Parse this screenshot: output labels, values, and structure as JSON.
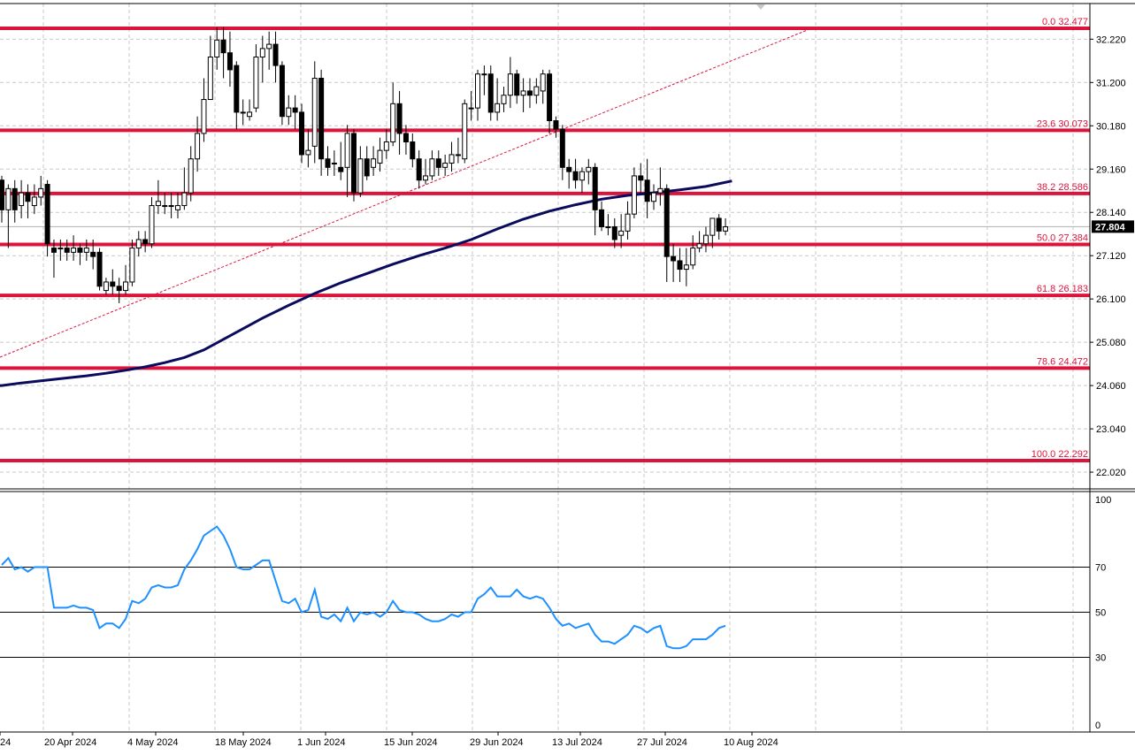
{
  "chart_data": [
    {
      "type": "candlestick",
      "price_axis_ticks": [
        "32.220",
        "31.200",
        "30.180",
        "29.160",
        "28.140",
        "27.120",
        "26.100",
        "25.080",
        "24.060",
        "23.040",
        "22.020"
      ],
      "date_labels": [
        "24",
        "20 Apr 2024",
        "4 May 2024",
        "18 May 2024",
        "1 Jun 2024",
        "15 Jun 2024",
        "29 Jun 2024",
        "13 Jul 2024",
        "27 Jul 2024",
        "10 Aug 2024"
      ],
      "ylim": [
        21.75,
        32.75
      ],
      "current_price": "27.804",
      "fibonacci": [
        {
          "label": "0.0 32.477",
          "value": 32.477
        },
        {
          "label": "23.6 30.073",
          "value": 30.073
        },
        {
          "label": "38.2 28.586",
          "value": 28.586
        },
        {
          "label": "50.0 27.384",
          "value": 27.384
        },
        {
          "label": "61.8 26.183",
          "value": 26.183
        },
        {
          "label": "78.6 24.472",
          "value": 24.472
        },
        {
          "label": "100.0 22.292",
          "value": 22.292
        }
      ],
      "candles": [
        [
          28.9,
          28.2,
          29.0,
          27.9
        ],
        [
          28.2,
          28.7,
          28.8,
          27.3
        ],
        [
          28.7,
          28.2,
          28.9,
          27.9
        ],
        [
          28.3,
          28.6,
          28.9,
          28.0
        ],
        [
          28.6,
          28.4,
          28.8,
          28.0
        ],
        [
          28.3,
          28.5,
          28.8,
          28.1
        ],
        [
          28.5,
          28.7,
          29.0,
          28.3
        ],
        [
          28.8,
          27.4,
          28.9,
          27.1
        ],
        [
          27.3,
          27.2,
          27.5,
          26.6
        ],
        [
          27.3,
          27.3,
          27.5,
          27.0
        ],
        [
          27.3,
          27.2,
          27.5,
          27.0
        ],
        [
          27.2,
          27.3,
          27.6,
          27.0
        ],
        [
          27.3,
          27.2,
          27.4,
          26.9
        ],
        [
          27.2,
          27.3,
          27.5,
          27.0
        ],
        [
          27.2,
          27.1,
          27.5,
          26.8
        ],
        [
          27.2,
          26.4,
          27.3,
          26.3
        ],
        [
          26.3,
          26.5,
          26.6,
          26.2
        ],
        [
          26.5,
          26.4,
          26.8,
          26.2
        ],
        [
          26.4,
          26.3,
          26.6,
          26.0
        ],
        [
          26.3,
          26.5,
          26.9,
          26.2
        ],
        [
          26.5,
          27.3,
          27.5,
          26.4
        ],
        [
          27.3,
          27.5,
          27.7,
          27.1
        ],
        [
          27.5,
          27.4,
          27.7,
          27.2
        ],
        [
          27.4,
          28.3,
          28.5,
          27.3
        ],
        [
          28.3,
          28.4,
          28.9,
          28.1
        ],
        [
          28.3,
          28.3,
          28.6,
          28.1
        ],
        [
          28.3,
          28.3,
          28.6,
          28.0
        ],
        [
          28.2,
          28.3,
          28.6,
          28.0
        ],
        [
          28.3,
          28.6,
          29.2,
          28.2
        ],
        [
          28.6,
          29.4,
          29.7,
          28.4
        ],
        [
          29.4,
          30.0,
          30.4,
          29.1
        ],
        [
          30.0,
          30.8,
          31.3,
          29.8
        ],
        [
          30.8,
          31.8,
          32.3,
          30.8
        ],
        [
          31.8,
          32.2,
          32.5,
          31.5
        ],
        [
          32.2,
          31.9,
          32.5,
          31.3
        ],
        [
          31.9,
          31.5,
          32.4,
          31.1
        ],
        [
          31.6,
          30.5,
          31.7,
          30.1
        ],
        [
          30.5,
          30.5,
          30.8,
          30.2
        ],
        [
          30.4,
          30.5,
          30.8,
          30.3
        ],
        [
          30.6,
          31.8,
          32.1,
          30.5
        ],
        [
          31.8,
          32.0,
          32.3,
          31.2
        ],
        [
          32.0,
          32.1,
          32.4,
          31.5
        ],
        [
          32.1,
          31.6,
          32.4,
          31.2
        ],
        [
          31.6,
          30.4,
          31.7,
          30.2
        ],
        [
          30.4,
          30.6,
          30.9,
          30.2
        ],
        [
          30.6,
          30.5,
          30.9,
          30.1
        ],
        [
          30.5,
          29.5,
          30.7,
          29.3
        ],
        [
          29.5,
          29.6,
          30.1,
          29.2
        ],
        [
          29.7,
          31.3,
          31.7,
          29.3
        ],
        [
          31.3,
          29.4,
          31.5,
          29.0
        ],
        [
          29.4,
          29.2,
          29.7,
          29.0
        ],
        [
          29.3,
          29.3,
          29.6,
          29.0
        ],
        [
          29.2,
          29.1,
          29.8,
          28.9
        ],
        [
          29.2,
          30.0,
          30.2,
          28.5
        ],
        [
          30.0,
          28.6,
          30.1,
          28.4
        ],
        [
          28.6,
          29.4,
          29.7,
          28.5
        ],
        [
          29.4,
          29.0,
          29.7,
          28.9
        ],
        [
          29.2,
          29.4,
          29.7,
          29.0
        ],
        [
          29.3,
          29.6,
          29.9,
          29.1
        ],
        [
          29.6,
          29.8,
          30.1,
          29.4
        ],
        [
          29.8,
          30.7,
          31.2,
          29.7
        ],
        [
          30.7,
          30.0,
          31.0,
          29.5
        ],
        [
          30.0,
          29.8,
          30.2,
          29.5
        ],
        [
          29.8,
          29.4,
          30.0,
          29.2
        ],
        [
          29.4,
          28.9,
          29.6,
          28.7
        ],
        [
          28.9,
          29.0,
          29.4,
          28.8
        ],
        [
          29.0,
          29.4,
          29.6,
          28.9
        ],
        [
          29.4,
          29.2,
          29.6,
          29.0
        ],
        [
          29.2,
          29.3,
          29.5,
          29.0
        ],
        [
          29.3,
          29.5,
          29.8,
          29.1
        ],
        [
          29.5,
          29.5,
          29.9,
          29.3
        ],
        [
          29.4,
          30.7,
          30.8,
          29.3
        ],
        [
          30.6,
          30.6,
          31.0,
          30.3
        ],
        [
          30.6,
          31.4,
          31.5,
          30.3
        ],
        [
          31.4,
          31.4,
          31.6,
          30.9
        ],
        [
          31.4,
          30.5,
          31.6,
          30.3
        ],
        [
          30.5,
          30.7,
          31.3,
          30.3
        ],
        [
          30.7,
          30.9,
          31.1,
          30.5
        ],
        [
          30.9,
          31.4,
          31.8,
          30.6
        ],
        [
          31.4,
          30.9,
          31.5,
          30.7
        ],
        [
          30.9,
          31.0,
          31.3,
          30.5
        ],
        [
          31.0,
          30.9,
          31.3,
          30.6
        ],
        [
          30.9,
          31.1,
          31.3,
          30.7
        ],
        [
          31.0,
          31.4,
          31.5,
          30.7
        ],
        [
          31.4,
          30.3,
          31.5,
          30.0
        ],
        [
          30.3,
          30.1,
          30.4,
          29.9
        ],
        [
          30.1,
          29.2,
          30.2,
          28.9
        ],
        [
          29.2,
          29.1,
          29.4,
          28.7
        ],
        [
          29.1,
          28.9,
          29.4,
          28.7
        ],
        [
          28.9,
          29.1,
          29.2,
          28.6
        ],
        [
          29.1,
          29.2,
          29.4,
          28.8
        ],
        [
          29.2,
          28.2,
          29.3,
          27.6
        ],
        [
          28.2,
          27.8,
          28.4,
          27.7
        ],
        [
          27.8,
          27.8,
          28.1,
          27.6
        ],
        [
          27.8,
          27.5,
          28.0,
          27.3
        ],
        [
          27.6,
          27.7,
          28.1,
          27.3
        ],
        [
          27.7,
          28.1,
          28.4,
          27.5
        ],
        [
          28.1,
          29.0,
          29.2,
          28.0
        ],
        [
          29.0,
          28.9,
          29.3,
          28.6
        ],
        [
          28.9,
          28.4,
          29.4,
          28.0
        ],
        [
          28.4,
          28.6,
          28.8,
          28.2
        ],
        [
          28.6,
          28.7,
          29.2,
          28.3
        ],
        [
          28.7,
          27.1,
          28.8,
          26.5
        ],
        [
          27.1,
          27.0,
          27.4,
          26.5
        ],
        [
          27.0,
          26.8,
          27.3,
          26.5
        ],
        [
          26.8,
          26.9,
          27.3,
          26.4
        ],
        [
          26.9,
          27.3,
          27.6,
          26.8
        ],
        [
          27.3,
          27.4,
          27.7,
          27.2
        ],
        [
          27.4,
          27.6,
          27.8,
          27.2
        ],
        [
          27.6,
          28.0,
          28.0,
          27.3
        ],
        [
          28.0,
          27.7,
          28.1,
          27.5
        ],
        [
          27.7,
          27.8,
          28.0,
          27.6
        ]
      ],
      "sma": [
        [
          0,
          24.06
        ],
        [
          3,
          24.12
        ],
        [
          6,
          24.17
        ],
        [
          10,
          24.24
        ],
        [
          13,
          24.29
        ],
        [
          16,
          24.35
        ],
        [
          19,
          24.42
        ],
        [
          22,
          24.5
        ],
        [
          25,
          24.6
        ],
        [
          28,
          24.72
        ],
        [
          31,
          24.9
        ],
        [
          34,
          25.15
        ],
        [
          37,
          25.4
        ],
        [
          40,
          25.65
        ],
        [
          44,
          25.95
        ],
        [
          48,
          26.23
        ],
        [
          52,
          26.48
        ],
        [
          56,
          26.7
        ],
        [
          60,
          26.92
        ],
        [
          64,
          27.12
        ],
        [
          68,
          27.3
        ],
        [
          72,
          27.5
        ],
        [
          76,
          27.75
        ],
        [
          80,
          27.98
        ],
        [
          84,
          28.17
        ],
        [
          88,
          28.32
        ],
        [
          92,
          28.45
        ],
        [
          96,
          28.54
        ],
        [
          100,
          28.6
        ],
        [
          104,
          28.67
        ],
        [
          108,
          28.75
        ],
        [
          112,
          28.88
        ]
      ]
    },
    {
      "type": "line",
      "levels": [
        "100",
        "70",
        "50",
        "30",
        "0"
      ],
      "ylim": [
        0,
        100
      ],
      "values": [
        71,
        74,
        69,
        70,
        68,
        70,
        70,
        70,
        52,
        52,
        52,
        53,
        52,
        52,
        51,
        43,
        45,
        45,
        43,
        47,
        55,
        54,
        56,
        61,
        62,
        61,
        61,
        62,
        69,
        73,
        78,
        84,
        86,
        88,
        84,
        78,
        70,
        69,
        69,
        71,
        73,
        73,
        64,
        55,
        54,
        56,
        50,
        51,
        60,
        48,
        47,
        49,
        46,
        52,
        46,
        50,
        49,
        50,
        48,
        50,
        55,
        51,
        50,
        50,
        49,
        47,
        46,
        46,
        47,
        49,
        48,
        50,
        50,
        56,
        58,
        61,
        57,
        57,
        57,
        60,
        57,
        56,
        57,
        56,
        52,
        47,
        44,
        45,
        43,
        44,
        45,
        40,
        37,
        37,
        36,
        38,
        40,
        44,
        43,
        41,
        43,
        44,
        35,
        34,
        34,
        35,
        38,
        38,
        38,
        40,
        43,
        44
      ]
    }
  ]
}
